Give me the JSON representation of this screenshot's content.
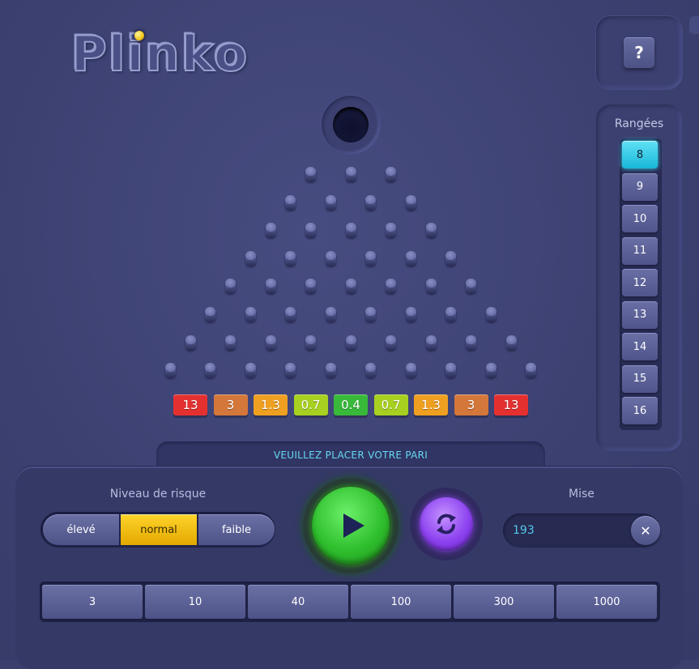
{
  "game": {
    "logo": "Plinko",
    "help_label": "?",
    "status": "VEUILLEZ PLACER VOTRE PARI"
  },
  "rows": {
    "title": "Rangées",
    "options": [
      "8",
      "9",
      "10",
      "11",
      "12",
      "13",
      "14",
      "15",
      "16"
    ],
    "selected": "8"
  },
  "board": {
    "peg_rows": [
      3,
      4,
      5,
      6,
      7,
      8,
      9,
      10
    ],
    "multipliers": [
      {
        "label": "13",
        "color": "#e53030"
      },
      {
        "label": "3",
        "color": "#d4773a"
      },
      {
        "label": "1.3",
        "color": "#f0a020"
      },
      {
        "label": "0.7",
        "color": "#a8d020"
      },
      {
        "label": "0.4",
        "color": "#38b93a"
      },
      {
        "label": "0.7",
        "color": "#a8d020"
      },
      {
        "label": "1.3",
        "color": "#f0a020"
      },
      {
        "label": "3",
        "color": "#d4773a"
      },
      {
        "label": "13",
        "color": "#e53030"
      }
    ]
  },
  "controls": {
    "risk_label": "Niveau de risque",
    "risk_options": [
      "élevé",
      "normal",
      "faible"
    ],
    "risk_selected": "normal",
    "bet_label": "Mise",
    "bet_value": "193",
    "clear_label": "✕",
    "chips": [
      "3",
      "10",
      "40",
      "100",
      "300",
      "1000"
    ]
  },
  "colors": {
    "accent_cyan": "#19b7d8",
    "risk_selected": "#ffcc18",
    "play": "#2fbf2d",
    "autoplay": "#8d43f0"
  }
}
